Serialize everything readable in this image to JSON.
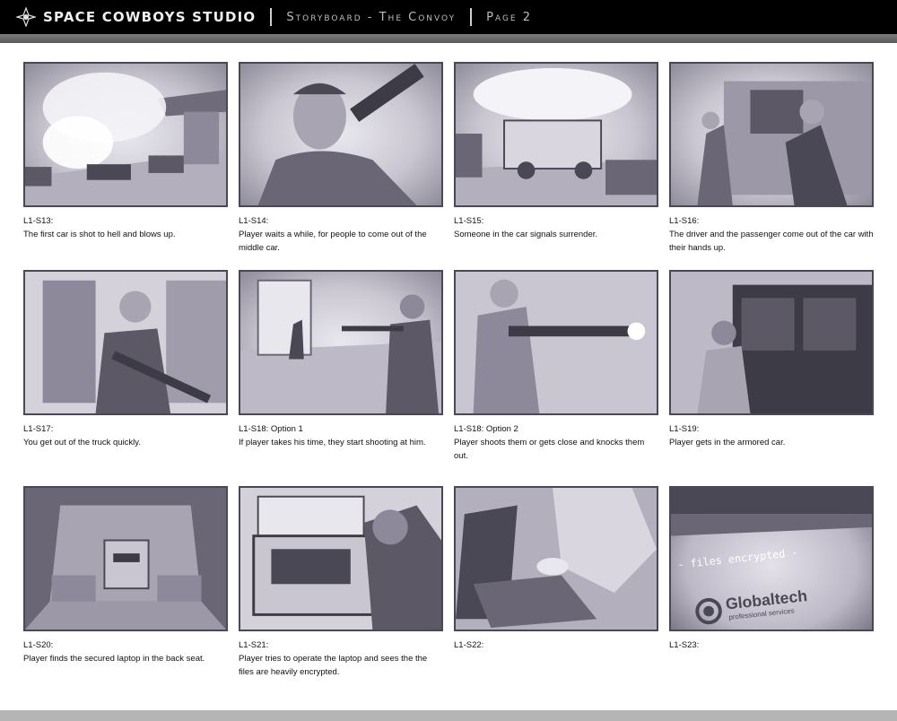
{
  "header": {
    "studio": "SPACE COWBOYS STUDIO",
    "title": "Storyboard - The Convoy",
    "page": "Page 2"
  },
  "panels": [
    {
      "id": "L1-S13:",
      "desc": "The first car is shot to hell and blows up."
    },
    {
      "id": "L1-S14:",
      "desc": "Player waits a while, for people to come out of the middle car."
    },
    {
      "id": "L1-S15:",
      "desc": "Someone in the car signals surrender."
    },
    {
      "id": "L1-S16:",
      "desc": "The driver and the passenger come out of the car with their hands up."
    },
    {
      "id": "L1-S17:",
      "desc": "You get out of the truck quickly."
    },
    {
      "id": "L1-S18: Option 1",
      "desc": "If player takes his time, they start shooting at him."
    },
    {
      "id": "L1-S18: Option 2",
      "desc": "Player shoots them or gets close and knocks them out."
    },
    {
      "id": "L1-S19:",
      "desc": "Player gets in the armored car."
    },
    {
      "id": "L1-S20:",
      "desc": "Player finds the secured laptop in the back seat."
    },
    {
      "id": "L1-S21:",
      "desc": "Player tries to operate the laptop and sees the the files are heavily encrypted."
    },
    {
      "id": "L1-S22:",
      "desc": ""
    },
    {
      "id": "L1-S23:",
      "desc": ""
    }
  ],
  "screen_text": {
    "files": "- files encrypted -",
    "brand": "Globaltech",
    "tagline": "professional services"
  },
  "colors": {
    "header_bg": "#000000",
    "sketch_dark": "#4a4854",
    "sketch_light": "#e9e7ee"
  }
}
